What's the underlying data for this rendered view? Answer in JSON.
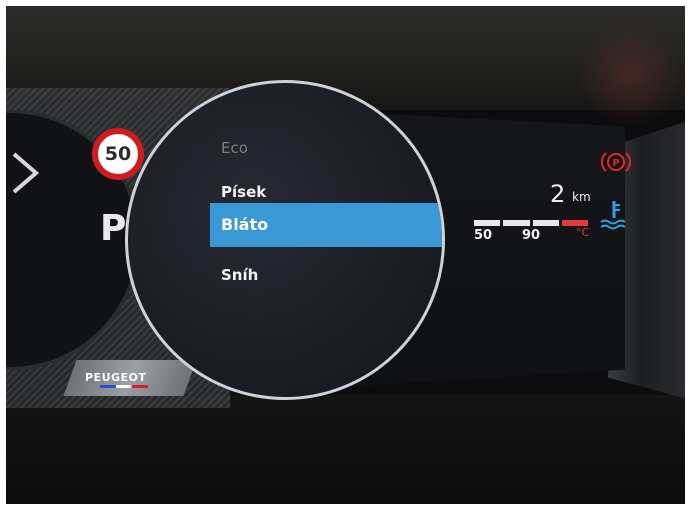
{
  "cluster": {
    "speed_limit": "50",
    "gear": "P",
    "brand": "PEUGEOT"
  },
  "drive_modes": {
    "items": [
      {
        "label": "Eco",
        "state": "dim"
      },
      {
        "label": "Písek",
        "state": "normal"
      },
      {
        "label": "Bláto",
        "state": "selected"
      },
      {
        "label": "Sníh",
        "state": "normal"
      }
    ],
    "highlight_color": "#3a98d4"
  },
  "range": {
    "value": "2",
    "unit": "km"
  },
  "temperature": {
    "labels": [
      "50",
      "90"
    ],
    "unit": "°C"
  },
  "icons": {
    "parking_brake": "parking-brake-icon",
    "coolant": "coolant-temperature-icon",
    "warning_color": "#e02828",
    "coolant_color": "#2fa3e6"
  }
}
